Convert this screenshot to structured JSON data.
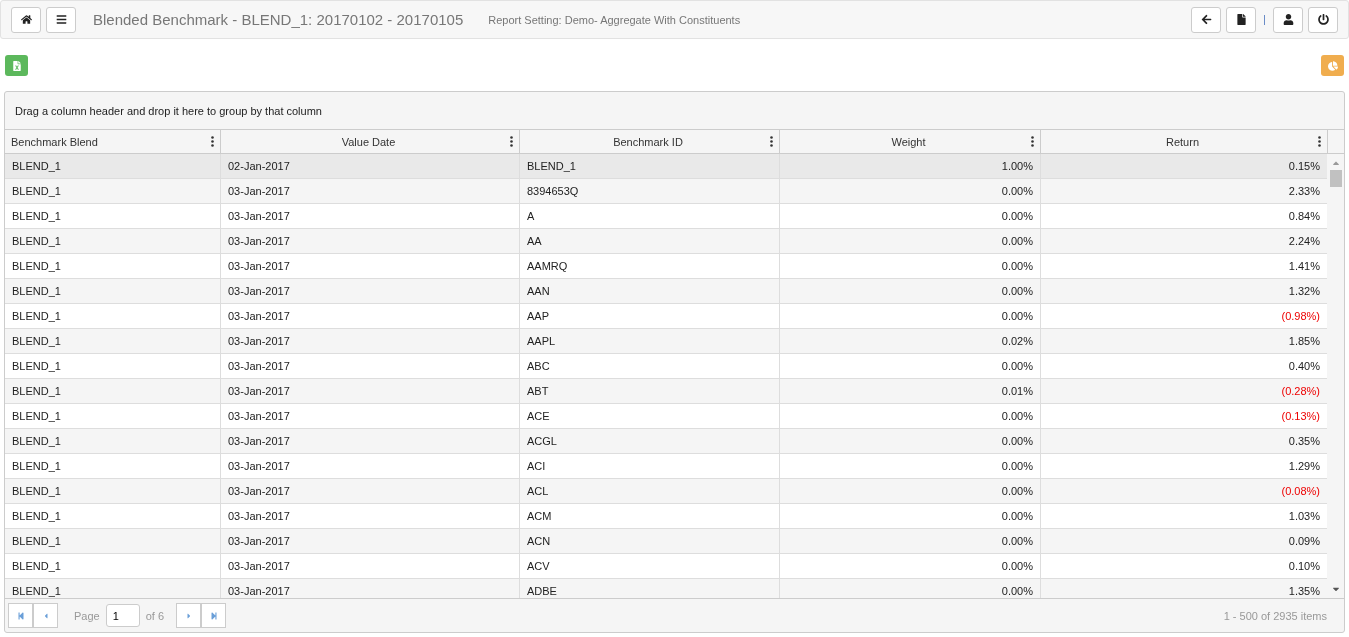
{
  "header": {
    "title": "Blended Benchmark - BLEND_1: 20170102 - 20170105",
    "subtitle": "Report Setting: Demo- Aggregate With Constituents"
  },
  "group_panel": "Drag a column header and drop it here to group by that column",
  "table": {
    "columns": [
      "Benchmark Blend",
      "Value Date",
      "Benchmark ID",
      "Weight",
      "Return"
    ],
    "rows": [
      {
        "cells": [
          "BLEND_1",
          "02-Jan-2017",
          "BLEND_1",
          "1.00%",
          "0.15%"
        ],
        "selected": true,
        "negative": false
      },
      {
        "cells": [
          "BLEND_1",
          "03-Jan-2017",
          "8394653Q",
          "0.00%",
          "2.33%"
        ],
        "selected": false,
        "negative": false
      },
      {
        "cells": [
          "BLEND_1",
          "03-Jan-2017",
          "A",
          "0.00%",
          "0.84%"
        ],
        "selected": false,
        "negative": false
      },
      {
        "cells": [
          "BLEND_1",
          "03-Jan-2017",
          "AA",
          "0.00%",
          "2.24%"
        ],
        "selected": false,
        "negative": false
      },
      {
        "cells": [
          "BLEND_1",
          "03-Jan-2017",
          "AAMRQ",
          "0.00%",
          "1.41%"
        ],
        "selected": false,
        "negative": false
      },
      {
        "cells": [
          "BLEND_1",
          "03-Jan-2017",
          "AAN",
          "0.00%",
          "1.32%"
        ],
        "selected": false,
        "negative": false
      },
      {
        "cells": [
          "BLEND_1",
          "03-Jan-2017",
          "AAP",
          "0.00%",
          "(0.98%)"
        ],
        "selected": false,
        "negative": true
      },
      {
        "cells": [
          "BLEND_1",
          "03-Jan-2017",
          "AAPL",
          "0.02%",
          "1.85%"
        ],
        "selected": false,
        "negative": false
      },
      {
        "cells": [
          "BLEND_1",
          "03-Jan-2017",
          "ABC",
          "0.00%",
          "0.40%"
        ],
        "selected": false,
        "negative": false
      },
      {
        "cells": [
          "BLEND_1",
          "03-Jan-2017",
          "ABT",
          "0.01%",
          "(0.28%)"
        ],
        "selected": false,
        "negative": true
      },
      {
        "cells": [
          "BLEND_1",
          "03-Jan-2017",
          "ACE",
          "0.00%",
          "(0.13%)"
        ],
        "selected": false,
        "negative": true
      },
      {
        "cells": [
          "BLEND_1",
          "03-Jan-2017",
          "ACGL",
          "0.00%",
          "0.35%"
        ],
        "selected": false,
        "negative": false
      },
      {
        "cells": [
          "BLEND_1",
          "03-Jan-2017",
          "ACI",
          "0.00%",
          "1.29%"
        ],
        "selected": false,
        "negative": false
      },
      {
        "cells": [
          "BLEND_1",
          "03-Jan-2017",
          "ACL",
          "0.00%",
          "(0.08%)"
        ],
        "selected": false,
        "negative": true
      },
      {
        "cells": [
          "BLEND_1",
          "03-Jan-2017",
          "ACM",
          "0.00%",
          "1.03%"
        ],
        "selected": false,
        "negative": false
      },
      {
        "cells": [
          "BLEND_1",
          "03-Jan-2017",
          "ACN",
          "0.00%",
          "0.09%"
        ],
        "selected": false,
        "negative": false
      },
      {
        "cells": [
          "BLEND_1",
          "03-Jan-2017",
          "ACV",
          "0.00%",
          "0.10%"
        ],
        "selected": false,
        "negative": false
      },
      {
        "cells": [
          "BLEND_1",
          "03-Jan-2017",
          "ADBE",
          "0.00%",
          "1.35%"
        ],
        "selected": false,
        "negative": false
      }
    ]
  },
  "pager": {
    "page_label": "Page",
    "page": "1",
    "of_label": "of 6",
    "summary": "1 - 500 of 2935 items"
  }
}
